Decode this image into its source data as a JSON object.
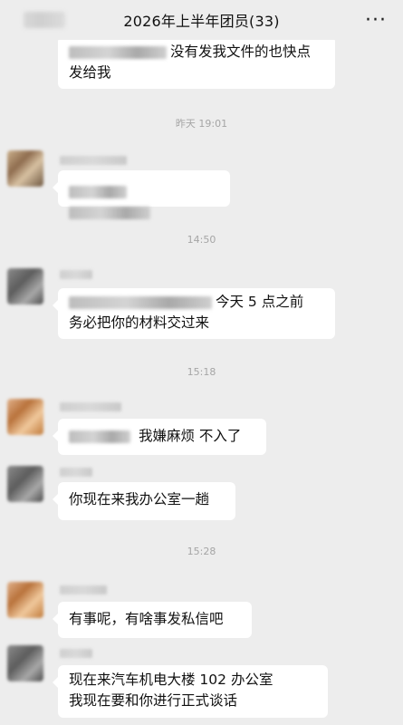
{
  "header": {
    "title": "2026年上半年团员(33)",
    "more_label": "···"
  },
  "messages": [
    {
      "line1": "没有发我文件的也快点",
      "line2": "发给我"
    },
    {
      "time": "昨天 19:01"
    },
    {
      "text": ""
    },
    {
      "time": "14:50"
    },
    {
      "line1": "今天 5 点之前",
      "line2": "务必把你的材料交过来"
    },
    {
      "time": "15:18"
    },
    {
      "text": "我嫌麻烦 不入了"
    },
    {
      "text": "你现在来我办公室一趟"
    },
    {
      "time": "15:28"
    },
    {
      "text": "有事呢，有啥事发私信吧"
    },
    {
      "line1": "现在来汽车机电大楼 102 办公室",
      "line2": "我现在要和你进行正式谈话"
    }
  ]
}
